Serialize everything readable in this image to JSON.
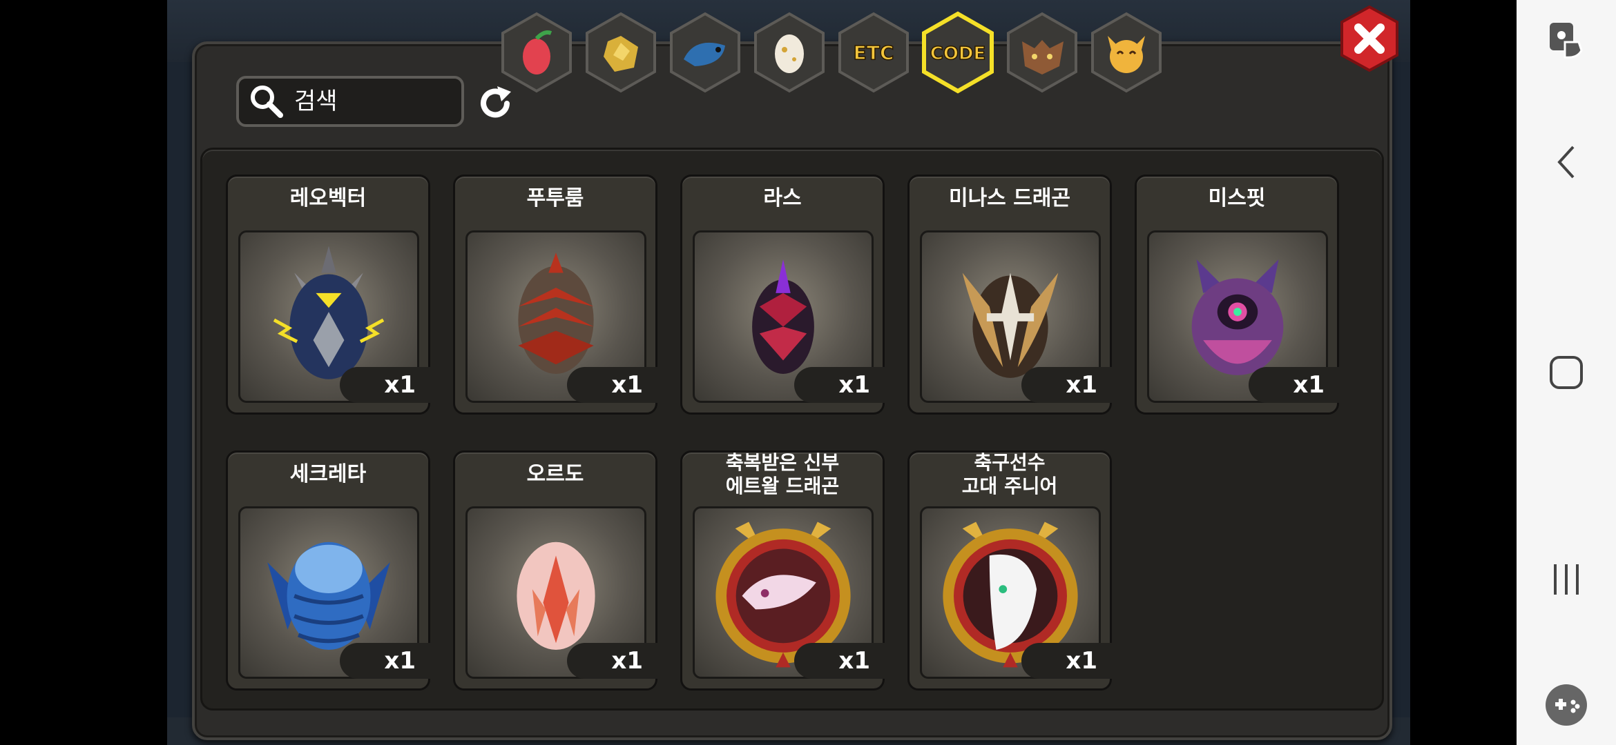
{
  "search": {
    "placeholder": "검색"
  },
  "tabs": [
    {
      "id": "fruit",
      "icon": "fruit-icon",
      "label": ""
    },
    {
      "id": "ore",
      "icon": "gold-ore-icon",
      "label": ""
    },
    {
      "id": "dragon-scale",
      "icon": "dragon-icon",
      "label": ""
    },
    {
      "id": "egg",
      "icon": "egg-icon",
      "label": ""
    },
    {
      "id": "etc",
      "icon": "",
      "label": "ETC"
    },
    {
      "id": "code",
      "icon": "",
      "label": "CODE",
      "selected": true
    },
    {
      "id": "beast",
      "icon": "wolf-head-icon",
      "label": ""
    },
    {
      "id": "pet",
      "icon": "cat-face-icon",
      "label": ""
    }
  ],
  "items": [
    {
      "name": "레오벡터",
      "qty": "x1",
      "icon": "thunder-egg-icon",
      "color": "#2b3a66"
    },
    {
      "name": "푸투룸",
      "qty": "x1",
      "icon": "spiked-egg-icon",
      "color": "#6b4b3d"
    },
    {
      "name": "라스",
      "qty": "x1",
      "icon": "dark-crystal-egg-icon",
      "color": "#5a1f3f"
    },
    {
      "name": "미나스 드래곤",
      "qty": "x1",
      "icon": "winged-helmet-egg-icon",
      "color": "#5c4a3a"
    },
    {
      "name": "미스핏",
      "qty": "x1",
      "icon": "eye-egg-icon",
      "color": "#6a3d7a"
    },
    {
      "name": "세크레타",
      "qty": "x1",
      "icon": "blue-scaled-egg-icon",
      "color": "#3468b3"
    },
    {
      "name": "오르도",
      "qty": "x1",
      "icon": "pink-crystal-egg-icon",
      "color": "#f2a9a0"
    },
    {
      "name": "축복받은 신부\n에트왈 드래곤",
      "line1": "축복받은 신부",
      "line2": "에트왈 드래곤",
      "qty": "x1",
      "icon": "gold-medallion-pink-dragon-icon",
      "color": "#d4a437"
    },
    {
      "name": "축구선수\n고대 주니어",
      "line1": "축구선수",
      "line2": "고대 주니어",
      "qty": "x1",
      "icon": "gold-medallion-white-dragon-icon",
      "color": "#d4a437"
    }
  ],
  "colors": {
    "panel": "#2d2c2a",
    "selected_tab_glow": "#f5e028",
    "close_button": "#d1262a"
  }
}
